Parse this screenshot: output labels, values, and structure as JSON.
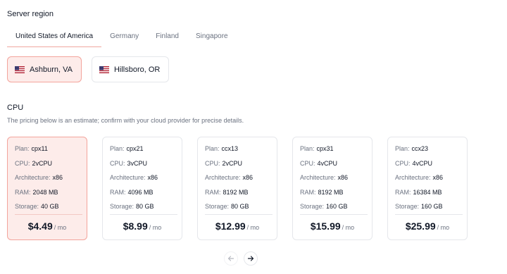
{
  "server_region": {
    "title": "Server region",
    "tabs": [
      "United States of America",
      "Germany",
      "Finland",
      "Singapore"
    ],
    "active_tab": "United States of America",
    "locations": [
      {
        "label": "Ashburn, VA",
        "flag": "us-flag-icon",
        "selected": true
      },
      {
        "label": "Hillsboro, OR",
        "flag": "us-flag-icon",
        "selected": false
      }
    ]
  },
  "cpu": {
    "title": "CPU",
    "note": "The pricing below is an estimate; confirm with your cloud provider for precise details.",
    "field_labels": {
      "plan": "Plan:",
      "cpu": "CPU:",
      "architecture": "Architecture:",
      "ram": "RAM:",
      "storage": "Storage:"
    },
    "per_label": "/ mo",
    "plans": [
      {
        "plan": "cpx11",
        "cpu": "2vCPU",
        "architecture": "x86",
        "ram": "2048 MB",
        "storage": "40 GB",
        "price": "$4.49",
        "selected": true
      },
      {
        "plan": "cpx21",
        "cpu": "3vCPU",
        "architecture": "x86",
        "ram": "4096 MB",
        "storage": "80 GB",
        "price": "$8.99",
        "selected": false
      },
      {
        "plan": "ccx13",
        "cpu": "2vCPU",
        "architecture": "x86",
        "ram": "8192 MB",
        "storage": "80 GB",
        "price": "$12.99",
        "selected": false
      },
      {
        "plan": "cpx31",
        "cpu": "4vCPU",
        "architecture": "x86",
        "ram": "8192 MB",
        "storage": "160 GB",
        "price": "$15.99",
        "selected": false
      },
      {
        "plan": "ccx23",
        "cpu": "4vCPU",
        "architecture": "x86",
        "ram": "16384 MB",
        "storage": "160 GB",
        "price": "$25.99",
        "selected": false
      }
    ]
  },
  "pagination": {
    "prev_icon": "arrow-left-icon",
    "next_icon": "arrow-right-icon",
    "prev_disabled": true
  },
  "colors": {
    "accent_border": "#f3a49c",
    "accent_bg": "#fdecea",
    "muted_text": "#6b7280"
  }
}
